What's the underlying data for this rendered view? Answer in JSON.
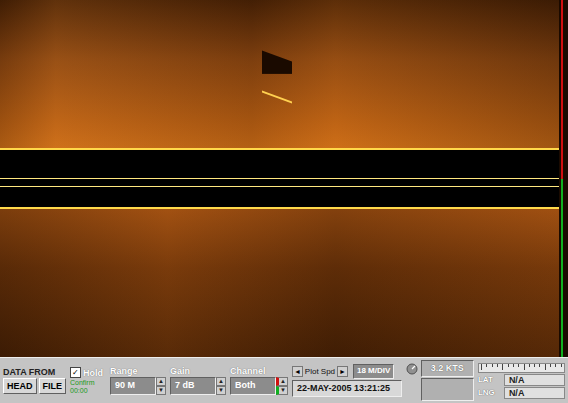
{
  "sonar_channels": [
    {
      "color": "#d01010"
    },
    {
      "color": "#10b020"
    }
  ],
  "toolbar": {
    "data_from": {
      "label": "DATA FROM",
      "buttons": [
        {
          "label": "HEAD",
          "selected": false
        },
        {
          "label": "FILE",
          "selected": false
        }
      ]
    },
    "hold": {
      "label": "Hold",
      "checked": true,
      "status": [
        "Confirm",
        "00:00"
      ]
    },
    "spin_up": "▲",
    "spin_down": "▼",
    "range": {
      "label": "Range",
      "value": "90 M"
    },
    "gain": {
      "label": "Gain",
      "value": "7 dB"
    },
    "channel": {
      "label": "Channel",
      "value": "Both"
    },
    "plot_speed": {
      "prev": "◄",
      "label": "Plot Spd",
      "next": "►",
      "value": "18 M/DIV"
    },
    "datetime": "22-MAY-2005 13:21:25",
    "speed": {
      "value": "3.2 KTS",
      "extra": ""
    },
    "position": [
      {
        "label": "LAT",
        "value": "N/A"
      },
      {
        "label": "LNG",
        "value": "N/A"
      }
    ]
  }
}
